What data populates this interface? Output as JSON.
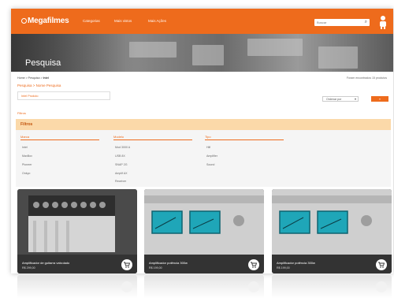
{
  "header": {
    "logo": "Megafilmes",
    "nav": [
      "Categorias",
      "Mais vistos",
      "Mais Ações"
    ],
    "search_placeholder": "Buscar"
  },
  "banner": {
    "title": "Pesquisa"
  },
  "breadcrumb": {
    "prefix": "Home > Pesquisa > ",
    "current": "Intel"
  },
  "results_text": "Foram encontrados 15 produtos",
  "search_link": "Pesquisa > Nome Pesquisa",
  "search_input_value": "Intel Produto",
  "sort": {
    "selected": "Ordenar por"
  },
  "next_button": "»",
  "filter_label": "Filtros",
  "filter_panel": {
    "title": "Filtros",
    "columns": [
      {
        "header": "Marca",
        "items": [
          "Intel",
          "MaxBox",
          "Pioneer",
          "Onkyo"
        ]
      },
      {
        "header": "Modelo",
        "items": [
          "Mod 3000 A",
          "USB 8X",
          "SNAP 2G",
          "Amplif AX",
          "Receiver"
        ]
      },
      {
        "header": "Tipo",
        "items": [
          "Hifi",
          "Amplifier",
          "Sound"
        ]
      }
    ]
  },
  "products": [
    {
      "name": "Amplificador de guitarra valvulado",
      "price": "R$ 299,00"
    },
    {
      "name": "Amplificador potência 300w",
      "price": "R$ 199,00"
    },
    {
      "name": "Amplificador potência 300w",
      "price": "R$ 199,00"
    }
  ],
  "colors": {
    "accent": "#ee6b1c",
    "panel_head": "#fbd9a9"
  },
  "icons": {
    "search": "search-icon",
    "user": "user-icon",
    "cart": "cart-icon"
  }
}
